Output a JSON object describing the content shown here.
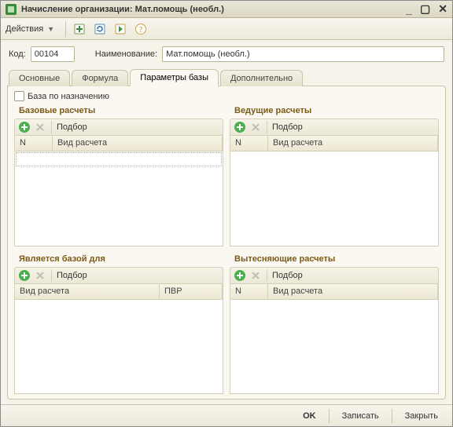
{
  "title": "Начисление организации: Мат.помощь (необл.)",
  "toolbar": {
    "actions_label": "Действия"
  },
  "form": {
    "code_label": "Код:",
    "code_value": "00104",
    "name_label": "Наименование:",
    "name_value": "Мат.помощь (необл.)"
  },
  "tabs": {
    "t0": "Основные",
    "t1": "Формула",
    "t2": "Параметры базы",
    "t3": "Дополнительно",
    "active": 2
  },
  "params": {
    "checkbox_label": "База по назначению",
    "panels": {
      "p0": {
        "title": "Базовые расчеты",
        "pick": "Подбор",
        "cols": {
          "c0": "N",
          "c1": "Вид расчета"
        }
      },
      "p1": {
        "title": "Ведущие расчеты",
        "pick": "Подбор",
        "cols": {
          "c0": "N",
          "c1": "Вид расчета"
        }
      },
      "p2": {
        "title": "Является базой для",
        "pick": "Подбор",
        "cols": {
          "c0": "Вид расчета",
          "c1": "ПВР"
        }
      },
      "p3": {
        "title": "Вытесняющие расчеты",
        "pick": "Подбор",
        "cols": {
          "c0": "N",
          "c1": "Вид расчета"
        }
      }
    }
  },
  "buttons": {
    "ok": "OK",
    "save": "Записать",
    "close": "Закрыть"
  }
}
